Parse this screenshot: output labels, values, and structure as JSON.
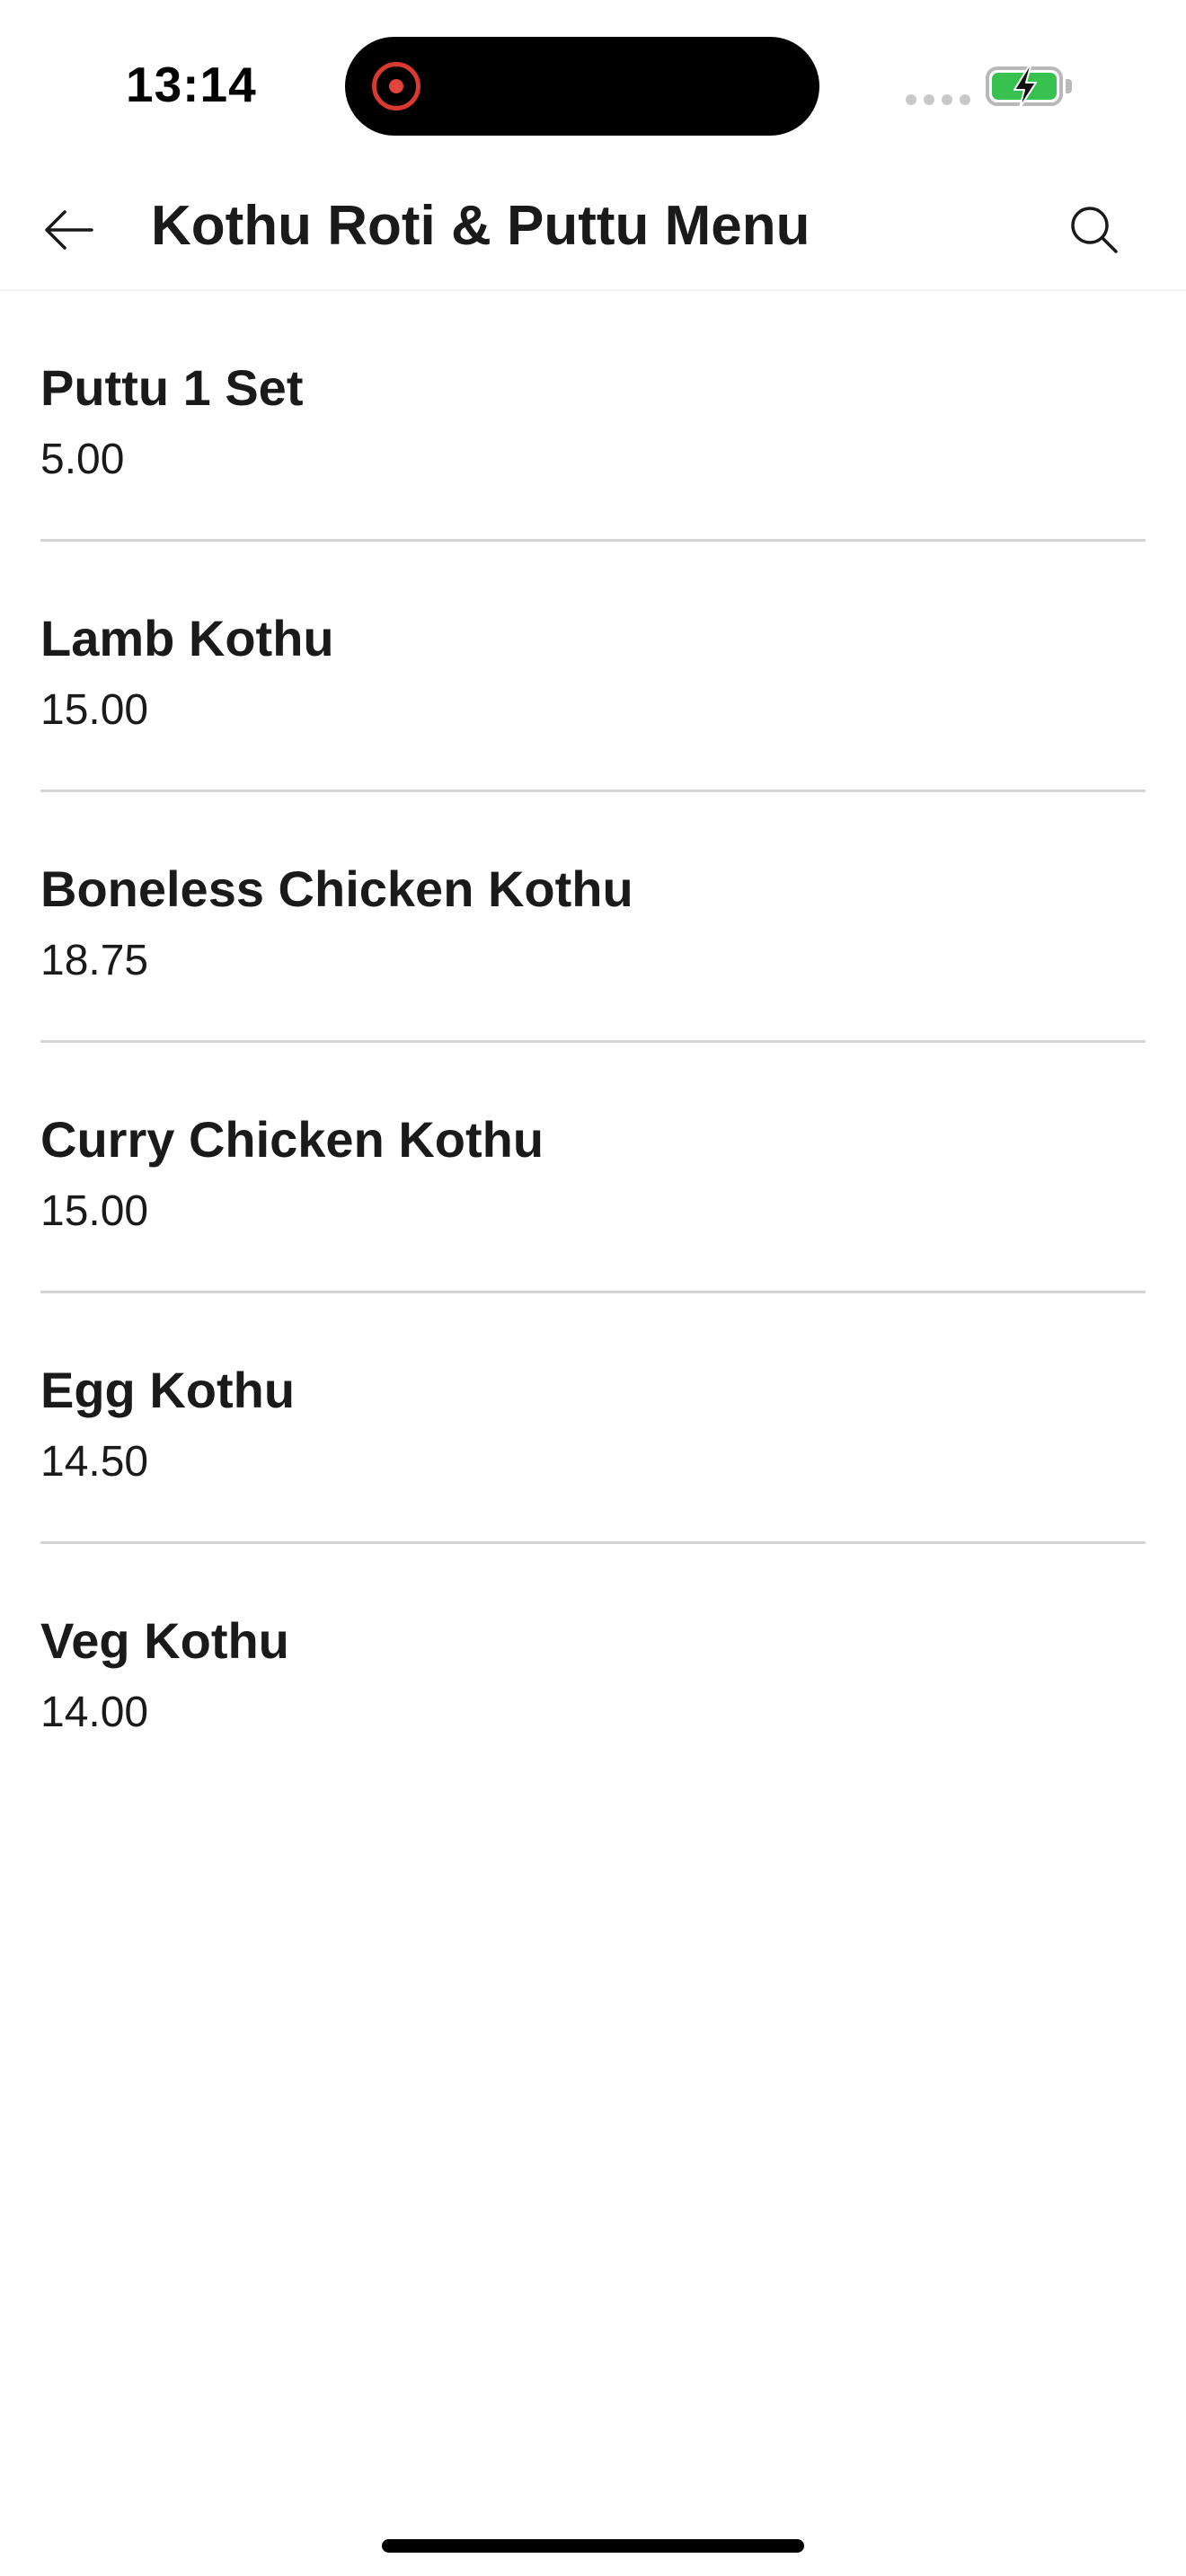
{
  "status_bar": {
    "time": "13:14",
    "icons": [
      "recording-indicator-icon",
      "cellular-signal-icon",
      "battery-charging-icon"
    ],
    "colors": {
      "recording": "#e0443a",
      "battery_fill": "#37c24f"
    }
  },
  "header": {
    "title": "Kothu Roti & Puttu Menu",
    "back_icon": "arrow-left-icon",
    "search_icon": "search-icon"
  },
  "menu": {
    "items": [
      {
        "name": "Puttu 1 Set",
        "price": "5.00"
      },
      {
        "name": "Lamb Kothu",
        "price": "15.00"
      },
      {
        "name": "Boneless Chicken Kothu",
        "price": "18.75"
      },
      {
        "name": "Curry Chicken Kothu",
        "price": "15.00"
      },
      {
        "name": "Egg Kothu",
        "price": "14.50"
      },
      {
        "name": "Veg Kothu",
        "price": "14.00"
      }
    ]
  }
}
